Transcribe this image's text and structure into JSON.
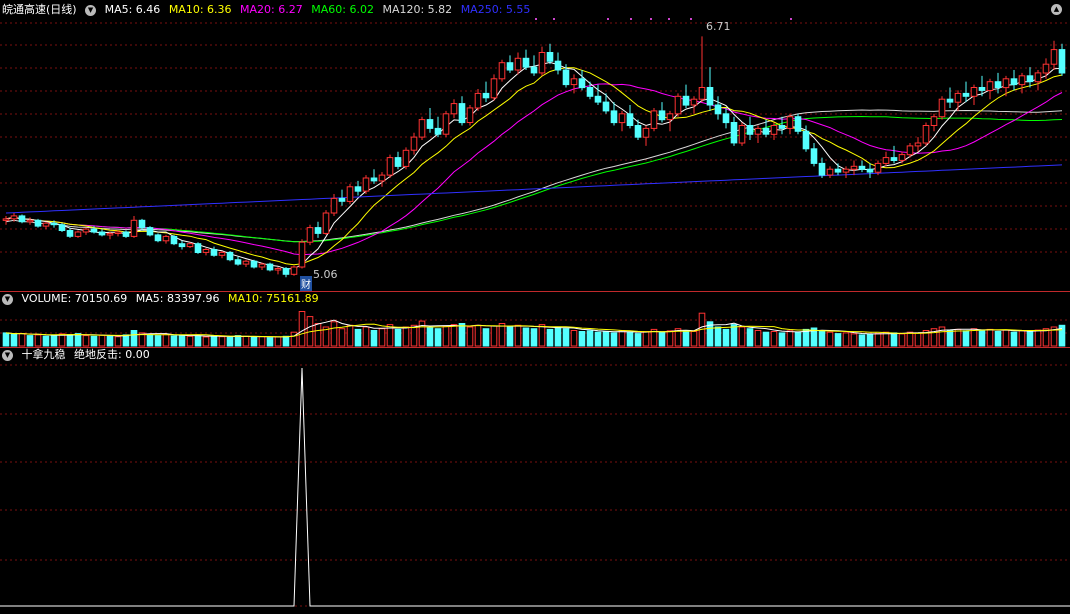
{
  "header": {
    "title": "皖通高速(日线)",
    "indicators": [
      {
        "label": "MA5: 6.46",
        "color": "#ffffff"
      },
      {
        "label": "MA10: 6.36",
        "color": "#ffff00"
      },
      {
        "label": "MA20: 6.27",
        "color": "#ff00ff"
      },
      {
        "label": "MA60: 6.02",
        "color": "#00ff00"
      },
      {
        "label": "MA120: 5.82",
        "color": "#d8d8d8"
      },
      {
        "label": "MA250: 5.55",
        "color": "#3030ff"
      }
    ]
  },
  "price_panel": {
    "high_label": "6.71",
    "low_label": "5.06",
    "event_tag": "财"
  },
  "volume_panel": {
    "label_volume": "VOLUME: 70150.69",
    "label_ma5": "MA5: 83397.96",
    "label_ma10": "MA10: 75161.89"
  },
  "indicator_panel": {
    "title": "十拿九稳",
    "value_label": "绝地反击: 0.00"
  },
  "colors": {
    "up": "#ff3232",
    "down": "#54ffff",
    "grid": "#7a1010",
    "separator": "#c0292b"
  },
  "chart_data": {
    "type": "candlestick",
    "ohlc": [
      [
        5.45,
        5.48,
        5.42,
        5.46
      ],
      [
        5.46,
        5.5,
        5.44,
        5.48
      ],
      [
        5.48,
        5.49,
        5.43,
        5.44
      ],
      [
        5.44,
        5.47,
        5.42,
        5.45
      ],
      [
        5.45,
        5.46,
        5.4,
        5.41
      ],
      [
        5.41,
        5.44,
        5.39,
        5.43
      ],
      [
        5.43,
        5.45,
        5.4,
        5.42
      ],
      [
        5.42,
        5.43,
        5.37,
        5.38
      ],
      [
        5.38,
        5.4,
        5.33,
        5.34
      ],
      [
        5.34,
        5.38,
        5.33,
        5.37
      ],
      [
        5.37,
        5.4,
        5.35,
        5.39
      ],
      [
        5.39,
        5.41,
        5.36,
        5.37
      ],
      [
        5.37,
        5.39,
        5.34,
        5.35
      ],
      [
        5.35,
        5.37,
        5.32,
        5.36
      ],
      [
        5.36,
        5.38,
        5.34,
        5.37
      ],
      [
        5.37,
        5.38,
        5.33,
        5.34
      ],
      [
        5.34,
        5.48,
        5.33,
        5.45
      ],
      [
        5.45,
        5.46,
        5.38,
        5.4
      ],
      [
        5.4,
        5.41,
        5.34,
        5.35
      ],
      [
        5.35,
        5.36,
        5.3,
        5.31
      ],
      [
        5.31,
        5.35,
        5.29,
        5.34
      ],
      [
        5.34,
        5.35,
        5.28,
        5.29
      ],
      [
        5.29,
        5.31,
        5.25,
        5.27
      ],
      [
        5.27,
        5.3,
        5.26,
        5.29
      ],
      [
        5.29,
        5.3,
        5.22,
        5.23
      ],
      [
        5.23,
        5.26,
        5.21,
        5.25
      ],
      [
        5.25,
        5.27,
        5.2,
        5.21
      ],
      [
        5.21,
        5.24,
        5.19,
        5.23
      ],
      [
        5.23,
        5.24,
        5.17,
        5.18
      ],
      [
        5.18,
        5.2,
        5.14,
        5.15
      ],
      [
        5.15,
        5.18,
        5.13,
        5.17
      ],
      [
        5.17,
        5.18,
        5.12,
        5.13
      ],
      [
        5.13,
        5.16,
        5.11,
        5.15
      ],
      [
        5.15,
        5.16,
        5.1,
        5.11
      ],
      [
        5.11,
        5.13,
        5.08,
        5.12
      ],
      [
        5.12,
        5.13,
        5.06,
        5.08
      ],
      [
        5.08,
        5.14,
        5.07,
        5.13
      ],
      [
        5.13,
        5.32,
        5.12,
        5.3
      ],
      [
        5.3,
        5.42,
        5.28,
        5.4
      ],
      [
        5.4,
        5.44,
        5.33,
        5.36
      ],
      [
        5.36,
        5.52,
        5.35,
        5.5
      ],
      [
        5.5,
        5.63,
        5.48,
        5.6
      ],
      [
        5.6,
        5.66,
        5.55,
        5.58
      ],
      [
        5.58,
        5.7,
        5.56,
        5.68
      ],
      [
        5.68,
        5.72,
        5.62,
        5.65
      ],
      [
        5.65,
        5.76,
        5.63,
        5.74
      ],
      [
        5.74,
        5.8,
        5.7,
        5.72
      ],
      [
        5.72,
        5.78,
        5.68,
        5.76
      ],
      [
        5.76,
        5.9,
        5.74,
        5.88
      ],
      [
        5.88,
        5.92,
        5.8,
        5.82
      ],
      [
        5.82,
        5.95,
        5.8,
        5.93
      ],
      [
        5.93,
        6.05,
        5.9,
        6.02
      ],
      [
        6.02,
        6.16,
        6.0,
        6.14
      ],
      [
        6.14,
        6.22,
        6.05,
        6.08
      ],
      [
        6.08,
        6.16,
        6.02,
        6.04
      ],
      [
        6.04,
        6.2,
        6.02,
        6.18
      ],
      [
        6.18,
        6.28,
        6.15,
        6.25
      ],
      [
        6.25,
        6.3,
        6.1,
        6.12
      ],
      [
        6.12,
        6.24,
        6.1,
        6.22
      ],
      [
        6.22,
        6.35,
        6.2,
        6.32
      ],
      [
        6.32,
        6.4,
        6.26,
        6.29
      ],
      [
        6.29,
        6.45,
        6.27,
        6.42
      ],
      [
        6.42,
        6.55,
        6.4,
        6.53
      ],
      [
        6.53,
        6.58,
        6.46,
        6.48
      ],
      [
        6.48,
        6.6,
        6.45,
        6.56
      ],
      [
        6.56,
        6.62,
        6.48,
        6.5
      ],
      [
        6.5,
        6.58,
        6.44,
        6.46
      ],
      [
        6.46,
        6.64,
        6.44,
        6.6
      ],
      [
        6.6,
        6.66,
        6.52,
        6.54
      ],
      [
        6.54,
        6.6,
        6.45,
        6.48
      ],
      [
        6.48,
        6.52,
        6.36,
        6.38
      ],
      [
        6.38,
        6.45,
        6.32,
        6.42
      ],
      [
        6.42,
        6.48,
        6.34,
        6.36
      ],
      [
        6.36,
        6.4,
        6.28,
        6.3
      ],
      [
        6.3,
        6.38,
        6.24,
        6.26
      ],
      [
        6.26,
        6.32,
        6.18,
        6.2
      ],
      [
        6.2,
        6.26,
        6.1,
        6.12
      ],
      [
        6.12,
        6.2,
        6.06,
        6.18
      ],
      [
        6.18,
        6.24,
        6.08,
        6.1
      ],
      [
        6.1,
        6.14,
        6.0,
        6.02
      ],
      [
        6.02,
        6.1,
        5.96,
        6.08
      ],
      [
        6.08,
        6.22,
        6.06,
        6.2
      ],
      [
        6.2,
        6.26,
        6.12,
        6.14
      ],
      [
        6.14,
        6.2,
        6.06,
        6.18
      ],
      [
        6.18,
        6.32,
        6.16,
        6.3
      ],
      [
        6.3,
        6.38,
        6.22,
        6.24
      ],
      [
        6.24,
        6.3,
        6.18,
        6.28
      ],
      [
        6.28,
        6.71,
        6.26,
        6.36
      ],
      [
        6.36,
        6.5,
        6.2,
        6.24
      ],
      [
        6.24,
        6.3,
        6.14,
        6.18
      ],
      [
        6.18,
        6.22,
        6.08,
        6.12
      ],
      [
        6.12,
        6.16,
        5.96,
        5.98
      ],
      [
        5.98,
        6.12,
        5.96,
        6.1
      ],
      [
        6.1,
        6.16,
        6.0,
        6.04
      ],
      [
        6.04,
        6.1,
        5.98,
        6.08
      ],
      [
        6.08,
        6.14,
        6.02,
        6.04
      ],
      [
        6.04,
        6.12,
        6.0,
        6.1
      ],
      [
        6.1,
        6.16,
        6.04,
        6.08
      ],
      [
        6.08,
        6.18,
        6.04,
        6.16
      ],
      [
        6.16,
        6.18,
        6.04,
        6.06
      ],
      [
        6.06,
        6.1,
        5.92,
        5.94
      ],
      [
        5.94,
        5.98,
        5.82,
        5.84
      ],
      [
        5.84,
        5.88,
        5.74,
        5.76
      ],
      [
        5.76,
        5.82,
        5.74,
        5.8
      ],
      [
        5.8,
        5.84,
        5.76,
        5.78
      ],
      [
        5.78,
        5.82,
        5.74,
        5.8
      ],
      [
        5.8,
        5.86,
        5.76,
        5.82
      ],
      [
        5.82,
        5.86,
        5.78,
        5.8
      ],
      [
        5.8,
        5.84,
        5.74,
        5.78
      ],
      [
        5.78,
        5.86,
        5.76,
        5.84
      ],
      [
        5.84,
        5.92,
        5.82,
        5.88
      ],
      [
        5.88,
        5.96,
        5.84,
        5.86
      ],
      [
        5.86,
        5.92,
        5.84,
        5.9
      ],
      [
        5.9,
        5.98,
        5.88,
        5.96
      ],
      [
        5.96,
        6.02,
        5.92,
        5.98
      ],
      [
        5.98,
        6.12,
        5.96,
        6.1
      ],
      [
        6.1,
        6.18,
        6.06,
        6.16
      ],
      [
        6.16,
        6.3,
        6.14,
        6.28
      ],
      [
        6.28,
        6.36,
        6.22,
        6.26
      ],
      [
        6.26,
        6.34,
        6.2,
        6.32
      ],
      [
        6.32,
        6.4,
        6.26,
        6.3
      ],
      [
        6.3,
        6.38,
        6.24,
        6.36
      ],
      [
        6.36,
        6.44,
        6.3,
        6.34
      ],
      [
        6.34,
        6.42,
        6.28,
        6.4
      ],
      [
        6.4,
        6.46,
        6.32,
        6.36
      ],
      [
        6.36,
        6.44,
        6.3,
        6.42
      ],
      [
        6.42,
        6.48,
        6.34,
        6.38
      ],
      [
        6.38,
        6.46,
        6.32,
        6.44
      ],
      [
        6.44,
        6.5,
        6.36,
        6.4
      ],
      [
        6.4,
        6.48,
        6.34,
        6.46
      ],
      [
        6.46,
        6.56,
        6.42,
        6.52
      ],
      [
        6.52,
        6.68,
        6.48,
        6.62
      ],
      [
        6.62,
        6.66,
        6.44,
        6.46
      ]
    ],
    "volume": [
      [
        38,
        "d"
      ],
      [
        34,
        "d"
      ],
      [
        36,
        "u"
      ],
      [
        30,
        "d"
      ],
      [
        32,
        "u"
      ],
      [
        28,
        "d"
      ],
      [
        30,
        "d"
      ],
      [
        35,
        "u"
      ],
      [
        33,
        "d"
      ],
      [
        36,
        "d"
      ],
      [
        30,
        "u"
      ],
      [
        28,
        "d"
      ],
      [
        31,
        "u"
      ],
      [
        29,
        "d"
      ],
      [
        27,
        "u"
      ],
      [
        32,
        "d"
      ],
      [
        45,
        "d"
      ],
      [
        38,
        "u"
      ],
      [
        34,
        "d"
      ],
      [
        30,
        "d"
      ],
      [
        33,
        "u"
      ],
      [
        29,
        "d"
      ],
      [
        31,
        "d"
      ],
      [
        28,
        "u"
      ],
      [
        30,
        "d"
      ],
      [
        26,
        "u"
      ],
      [
        29,
        "d"
      ],
      [
        27,
        "u"
      ],
      [
        25,
        "d"
      ],
      [
        30,
        "d"
      ],
      [
        28,
        "u"
      ],
      [
        26,
        "d"
      ],
      [
        27,
        "u"
      ],
      [
        24,
        "d"
      ],
      [
        26,
        "u"
      ],
      [
        28,
        "d"
      ],
      [
        40,
        "u"
      ],
      [
        100,
        "u"
      ],
      [
        85,
        "u"
      ],
      [
        65,
        "u"
      ],
      [
        55,
        "u"
      ],
      [
        70,
        "u"
      ],
      [
        50,
        "u"
      ],
      [
        60,
        "u"
      ],
      [
        48,
        "d"
      ],
      [
        55,
        "u"
      ],
      [
        45,
        "d"
      ],
      [
        50,
        "u"
      ],
      [
        62,
        "u"
      ],
      [
        48,
        "d"
      ],
      [
        55,
        "u"
      ],
      [
        60,
        "u"
      ],
      [
        72,
        "u"
      ],
      [
        55,
        "d"
      ],
      [
        50,
        "d"
      ],
      [
        58,
        "u"
      ],
      [
        62,
        "u"
      ],
      [
        65,
        "d"
      ],
      [
        55,
        "u"
      ],
      [
        60,
        "u"
      ],
      [
        50,
        "d"
      ],
      [
        58,
        "u"
      ],
      [
        65,
        "u"
      ],
      [
        55,
        "d"
      ],
      [
        60,
        "u"
      ],
      [
        52,
        "d"
      ],
      [
        50,
        "d"
      ],
      [
        62,
        "u"
      ],
      [
        48,
        "d"
      ],
      [
        55,
        "d"
      ],
      [
        50,
        "d"
      ],
      [
        45,
        "u"
      ],
      [
        42,
        "d"
      ],
      [
        44,
        "d"
      ],
      [
        40,
        "d"
      ],
      [
        42,
        "d"
      ],
      [
        38,
        "d"
      ],
      [
        45,
        "u"
      ],
      [
        40,
        "d"
      ],
      [
        36,
        "d"
      ],
      [
        42,
        "u"
      ],
      [
        48,
        "u"
      ],
      [
        40,
        "d"
      ],
      [
        44,
        "u"
      ],
      [
        50,
        "u"
      ],
      [
        45,
        "d"
      ],
      [
        42,
        "u"
      ],
      [
        95,
        "u"
      ],
      [
        70,
        "d"
      ],
      [
        55,
        "d"
      ],
      [
        48,
        "d"
      ],
      [
        62,
        "d"
      ],
      [
        55,
        "u"
      ],
      [
        50,
        "d"
      ],
      [
        45,
        "u"
      ],
      [
        40,
        "d"
      ],
      [
        42,
        "u"
      ],
      [
        38,
        "d"
      ],
      [
        44,
        "u"
      ],
      [
        40,
        "d"
      ],
      [
        48,
        "d"
      ],
      [
        52,
        "d"
      ],
      [
        45,
        "d"
      ],
      [
        40,
        "u"
      ],
      [
        36,
        "d"
      ],
      [
        38,
        "u"
      ],
      [
        35,
        "u"
      ],
      [
        32,
        "d"
      ],
      [
        34,
        "d"
      ],
      [
        36,
        "u"
      ],
      [
        40,
        "u"
      ],
      [
        38,
        "d"
      ],
      [
        35,
        "u"
      ],
      [
        40,
        "u"
      ],
      [
        38,
        "u"
      ],
      [
        45,
        "u"
      ],
      [
        50,
        "u"
      ],
      [
        55,
        "u"
      ],
      [
        45,
        "d"
      ],
      [
        48,
        "u"
      ],
      [
        44,
        "d"
      ],
      [
        50,
        "u"
      ],
      [
        46,
        "d"
      ],
      [
        48,
        "u"
      ],
      [
        42,
        "d"
      ],
      [
        46,
        "u"
      ],
      [
        40,
        "d"
      ],
      [
        44,
        "u"
      ],
      [
        42,
        "d"
      ],
      [
        46,
        "u"
      ],
      [
        50,
        "u"
      ],
      [
        55,
        "u"
      ],
      [
        60,
        "d"
      ]
    ],
    "ylim": [
      5.0,
      6.85
    ],
    "signal_index": 37
  }
}
